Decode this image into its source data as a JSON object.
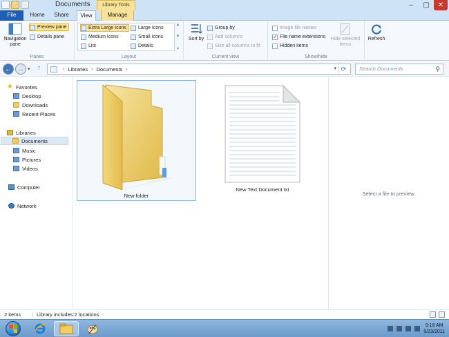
{
  "window": {
    "title": "Documents",
    "context_tab": "Library Tools",
    "controls": {
      "minimize": "–",
      "maximize": "▢",
      "close": "✕"
    }
  },
  "ribbon_tabs": [
    "File",
    "Home",
    "Share",
    "View",
    "Manage"
  ],
  "ribbon": {
    "panes": {
      "label": "Panes",
      "navigation_pane": "Navigation pane",
      "preview_pane": "Preview pane",
      "details_pane": "Details pane"
    },
    "layout": {
      "label": "Layout",
      "items": [
        "Extra Large Icons",
        "Large Icons",
        "Medium Icons",
        "Small Icons",
        "List",
        "Details"
      ]
    },
    "current_view": {
      "label": "Current view",
      "sort_by": "Sort by",
      "group_by": "Group by",
      "add_columns": "Add columns",
      "size_all_columns": "Size all columns to fit"
    },
    "show_hide": {
      "label": "Show/hide",
      "image_file_names": "Image file names",
      "image_file_names_checked": false,
      "file_name_extensions": "File name extensions",
      "file_name_extensions_checked": true,
      "hidden_items": "Hidden items",
      "hidden_items_checked": false,
      "hide_selected_items": "Hide selected items"
    },
    "refresh": "Refresh"
  },
  "address": {
    "crumbs": [
      "Libraries",
      "Documents"
    ],
    "search_placeholder": "Search Documents"
  },
  "nav_pane": {
    "favorites": {
      "label": "Favorites",
      "items": [
        "Desktop",
        "Downloads",
        "Recent Places"
      ]
    },
    "libraries": {
      "label": "Libraries",
      "items": [
        "Documents",
        "Music",
        "Pictures",
        "Videos"
      ]
    },
    "computer": "Computer",
    "network": "Network"
  },
  "files": [
    {
      "name": "New folder",
      "type": "folder",
      "selected": true
    },
    {
      "name": "New Text Document.txt",
      "type": "text",
      "selected": false
    }
  ],
  "preview_pane": {
    "message": "Select a file to preview."
  },
  "status_bar": {
    "item_count": "2 items",
    "library_info": "Library includes:2 locations"
  },
  "taskbar": {
    "time": "9:18 AM",
    "date": "9/23/2011"
  },
  "colors": {
    "file_tab": "#1f5fb4",
    "context_tab": "#f6e29a",
    "taskbar": "#7aa6d4",
    "selection": "#dbe8f6"
  }
}
